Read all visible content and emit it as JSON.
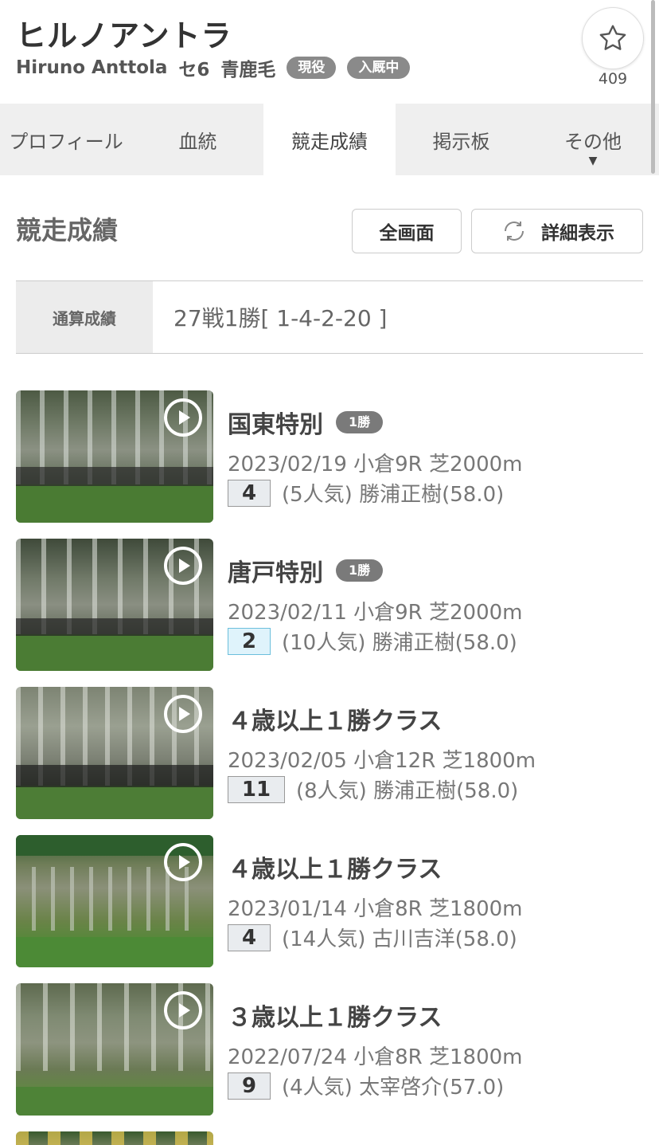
{
  "horse": {
    "name": "ヒルノアントラ",
    "romaji": "Hiruno Anttola",
    "sex_age": "セ6",
    "coat": "青鹿毛",
    "badges": [
      "現役",
      "入厩中"
    ],
    "favorite_count": "409"
  },
  "tabs": [
    {
      "label": "プロフィール"
    },
    {
      "label": "血統"
    },
    {
      "label": "競走成績"
    },
    {
      "label": "掲示板"
    },
    {
      "label": "その他"
    }
  ],
  "section": {
    "title": "競走成績",
    "fullscreen_label": "全画面",
    "detail_label": "詳細表示"
  },
  "summary": {
    "label": "通算成績",
    "value": "27戦1勝[ 1-4-2-20 ]"
  },
  "races": [
    {
      "name": "国東特別",
      "class": "1勝",
      "info": "2023/02/19 小倉9R 芝2000m",
      "finish": "4",
      "result": "(5人気) 勝浦正樹(58.0)"
    },
    {
      "name": "唐戸特別",
      "class": "1勝",
      "info": "2023/02/11 小倉9R 芝2000m",
      "finish": "2",
      "result": "(10人気) 勝浦正樹(58.0)"
    },
    {
      "name": "４歳以上１勝クラス",
      "class": "",
      "info": "2023/02/05 小倉12R 芝1800m",
      "finish": "11",
      "result": "(8人気) 勝浦正樹(58.0)"
    },
    {
      "name": "４歳以上１勝クラス",
      "class": "",
      "info": "2023/01/14 小倉8R 芝1800m",
      "finish": "4",
      "result": "(14人気) 古川吉洋(58.0)"
    },
    {
      "name": "３歳以上１勝クラス",
      "class": "",
      "info": "2022/07/24 小倉8R 芝1800m",
      "finish": "9",
      "result": "(4人気) 太宰啓介(57.0)"
    }
  ],
  "colors": {
    "badge_gray": "#8a8a8a",
    "place_highlight": "#dff3fb",
    "tab_bar": "#efefef"
  },
  "icons": [
    "star-icon",
    "refresh-icon",
    "play-icon",
    "caret-down-icon"
  ]
}
